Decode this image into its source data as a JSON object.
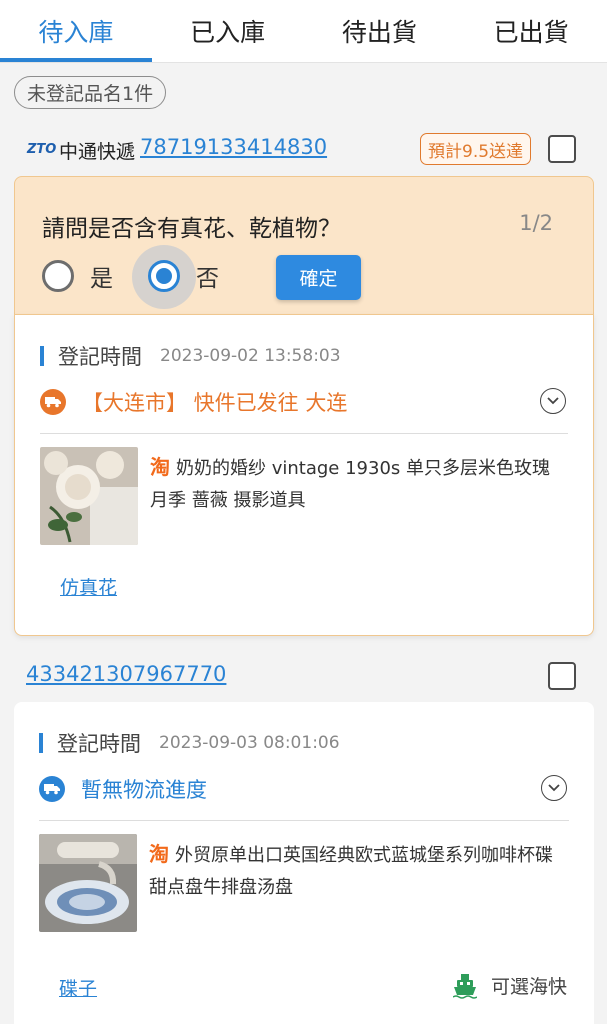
{
  "tabs": [
    {
      "label": "待入庫",
      "active": true
    },
    {
      "label": "已入庫",
      "active": false
    },
    {
      "label": "待出貨",
      "active": false
    },
    {
      "label": "已出貨",
      "active": false
    }
  ],
  "filter_chip": "未登記品名1件",
  "shipment1": {
    "carrier_logo": "ZTO",
    "carrier": "中通快遞",
    "tracking": "78719133414830",
    "eta": "預計9.5送達",
    "question": {
      "text": "請問是否含有真花、乾植物？",
      "page": "1/2",
      "option_yes": "是",
      "option_no": "否",
      "selected": "否",
      "confirm_label": "確定"
    },
    "card": {
      "reg_label": "登記時間",
      "reg_time": "2023-09-02 13:58:03",
      "status": "【大连市】 快件已发往 大连",
      "status_color": "#e8762b",
      "store_icon": "淘",
      "title": "奶奶的婚纱 vintage 1930s 单只多层米色玫瑰 月季 蔷薇 摄影道具",
      "category": "仿真花"
    }
  },
  "shipment2": {
    "tracking": "433421307967770",
    "card": {
      "reg_label": "登記時間",
      "reg_time": "2023-09-03 08:01:06",
      "status": "暫無物流進度",
      "status_color": "#2a83d4",
      "store_icon": "淘",
      "title": "外贸原单出口英国经典欧式蓝城堡系列咖啡杯碟甜点盘牛排盘汤盘",
      "category": "碟子",
      "shipping_option": "可選海快",
      "shipping_icon": "ship-icon"
    }
  },
  "colors": {
    "accent": "#2a83d4",
    "orange": "#e8762b",
    "question_bg": "#fbe5c9"
  }
}
